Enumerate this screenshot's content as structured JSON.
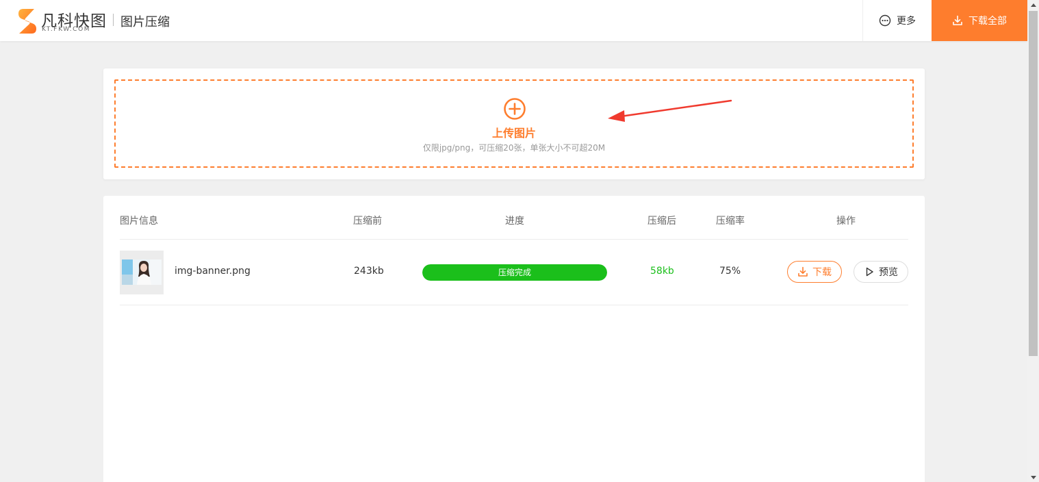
{
  "brand": {
    "name_cn": "凡科快图",
    "name_en": "KT.FKW.COM",
    "app_title": "图片压缩"
  },
  "header": {
    "more_label": "更多",
    "download_all_label": "下载全部"
  },
  "upload": {
    "label": "上传图片",
    "hint": "仅限jpg/png，可压缩20张，单张大小不可超20M"
  },
  "table": {
    "headers": {
      "info": "图片信息",
      "before": "压缩前",
      "progress": "进度",
      "after": "压缩后",
      "rate": "压缩率",
      "actions": "操作"
    },
    "rows": [
      {
        "filename": "img-banner.png",
        "size_before": "243kb",
        "progress_text": "压缩完成",
        "progress_percent": 100,
        "size_after": "58kb",
        "rate": "75%",
        "download_label": "下载",
        "preview_label": "预览"
      }
    ]
  },
  "colors": {
    "accent": "#fe7d2d",
    "success": "#1bbf1b",
    "arrow": "#f03a2e"
  },
  "icons": {
    "logo": "lightning-s-logo",
    "more": "ellipsis-circle-icon",
    "download": "download-icon",
    "upload": "plus-circle-icon",
    "preview": "play-triangle-icon"
  }
}
